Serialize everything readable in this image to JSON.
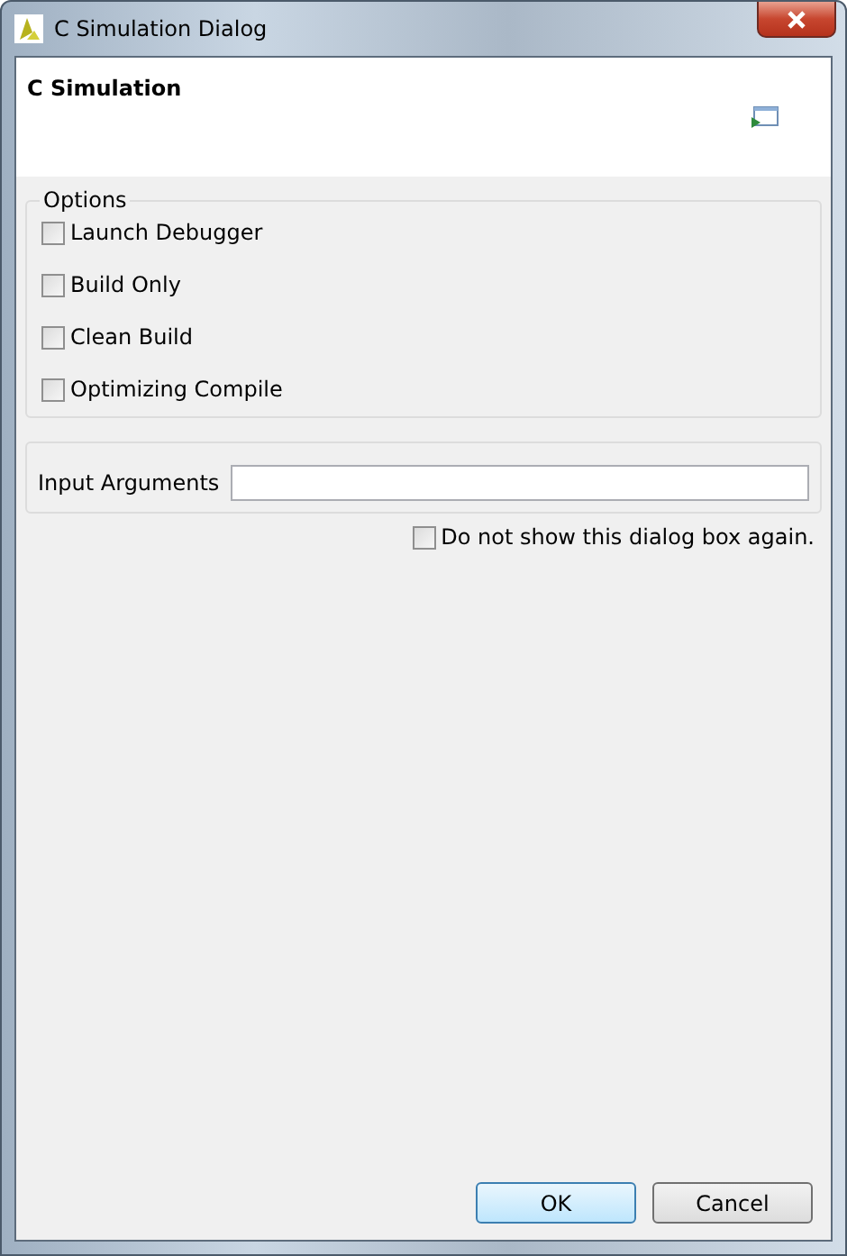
{
  "window": {
    "title": "C Simulation Dialog"
  },
  "header": {
    "title": "C Simulation"
  },
  "options": {
    "legend": "Options",
    "items": [
      {
        "label": "Launch Debugger",
        "checked": false
      },
      {
        "label": "Build Only",
        "checked": false
      },
      {
        "label": "Clean Build",
        "checked": false
      },
      {
        "label": "Optimizing Compile",
        "checked": false
      }
    ]
  },
  "input_arguments": {
    "label": "Input Arguments"
  },
  "dont_show": {
    "label": "Do not show this dialog box again.",
    "checked": false
  },
  "buttons": [
    {
      "label": "OK",
      "default": true
    },
    {
      "label": "Cancel",
      "default": false
    }
  ]
}
